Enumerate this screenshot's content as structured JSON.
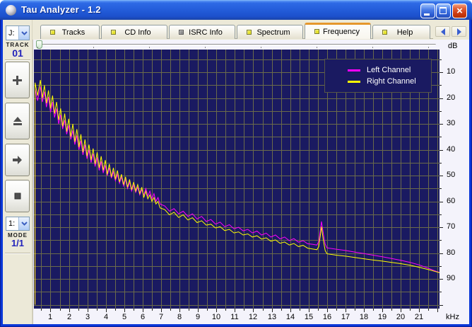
{
  "window": {
    "title": "Tau Analyzer - 1.2",
    "controls": {
      "minimize": "minimize",
      "maximize": "maximize",
      "close": "close"
    }
  },
  "sidebar": {
    "track_combo": {
      "value": "J:"
    },
    "track_label": "TRACK",
    "track_number": "01",
    "buttons": [
      {
        "icon": "plus"
      },
      {
        "icon": "eject"
      },
      {
        "icon": "arrow-right"
      },
      {
        "icon": "stop"
      }
    ],
    "mode_combo": {
      "value": "1:"
    },
    "mode_label": "MODE",
    "mode_value": "1/1"
  },
  "tabs": [
    {
      "label": "Tracks",
      "led": "on",
      "active": false
    },
    {
      "label": "CD Info",
      "led": "on",
      "active": false
    },
    {
      "label": "ISRC Info",
      "led": "off",
      "active": false
    },
    {
      "label": "Spectrum",
      "led": "on",
      "active": false
    },
    {
      "label": "Frequency",
      "led": "on",
      "active": true
    },
    {
      "label": "Help",
      "led": "on",
      "active": false
    }
  ],
  "legend": {
    "entries": [
      {
        "label": "Left Channel",
        "color": "#ff00ff"
      },
      {
        "label": "Right Channel",
        "color": "#ffff00"
      }
    ]
  },
  "colors": {
    "accent_orange": "#e5972d",
    "chart_bg": "#1a1a61",
    "grid": "#6b6b4a",
    "axis_bg": "#f4f3fb",
    "led_on": "#e8e431",
    "led_off": "#919191",
    "track_number_blue": "#2222bb",
    "left_channel": "#ff00ff",
    "right_channel": "#ffff00"
  },
  "chart_data": {
    "type": "line",
    "title": "",
    "xlabel": "kHz",
    "ylabel": "dB",
    "xlim": [
      0.1,
      22.1
    ],
    "ylim_db": [
      -101.5,
      -1.2
    ],
    "grid": {
      "x_step_khz": 0.5,
      "y_step_db": 5,
      "on": true
    },
    "legend_position": "top-right",
    "x_ticks": [
      "1",
      "2",
      "3",
      "4",
      "5",
      "6",
      "7",
      "8",
      "9",
      "10",
      "11",
      "12",
      "13",
      "14",
      "15",
      "16",
      "17",
      "18",
      "19",
      "20",
      "21"
    ],
    "y_ticks": [
      "10",
      "20",
      "30",
      "40",
      "50",
      "60",
      "70",
      "80",
      "90"
    ],
    "x_kHz": [
      0.16,
      0.16,
      0.3,
      0.45,
      0.56,
      0.67,
      0.78,
      0.89,
      1.0,
      1.11,
      1.22,
      1.33,
      1.44,
      1.55,
      1.66,
      1.77,
      1.88,
      1.99,
      2.1,
      2.21,
      2.32,
      2.43,
      2.54,
      2.65,
      2.76,
      2.87,
      2.98,
      3.09,
      3.2,
      3.31,
      3.42,
      3.53,
      3.64,
      3.75,
      3.86,
      3.97,
      4.08,
      4.19,
      4.3,
      4.41,
      4.52,
      4.63,
      4.74,
      4.85,
      4.96,
      5.07,
      5.18,
      5.29,
      5.4,
      5.51,
      5.62,
      5.73,
      5.84,
      5.95,
      6.06,
      6.17,
      6.28,
      6.39,
      6.5,
      6.61,
      6.72,
      6.83,
      6.94,
      7.2,
      7.45,
      7.7,
      7.95,
      8.2,
      8.45,
      8.7,
      8.95,
      9.2,
      9.45,
      9.7,
      9.95,
      10.2,
      10.45,
      10.7,
      10.95,
      11.2,
      11.45,
      11.7,
      11.95,
      12.2,
      12.45,
      12.7,
      12.95,
      13.2,
      13.45,
      13.7,
      13.95,
      14.2,
      14.45,
      14.7,
      14.95,
      15.2,
      15.45,
      15.55,
      15.65,
      15.7,
      15.8,
      15.9,
      16.0,
      16.5,
      17.0,
      17.5,
      18.0,
      18.5,
      19.0,
      19.5,
      20.0,
      20.5,
      21.0,
      21.5,
      21.9,
      22.1
    ],
    "series": [
      {
        "name": "Left Channel",
        "color": "#ff00ff",
        "db": [
          -100,
          -16.5,
          -21,
          -15.5,
          -21.5,
          -17.5,
          -23.5,
          -19.5,
          -25.5,
          -21.5,
          -27.5,
          -24.0,
          -30.0,
          -26.5,
          -32.0,
          -28.5,
          -34.0,
          -30.5,
          -36.0,
          -32.5,
          -38.0,
          -34.5,
          -40.0,
          -36.5,
          -42.0,
          -38.0,
          -43.5,
          -40.0,
          -45.0,
          -41.5,
          -46.5,
          -43.0,
          -48.0,
          -44.5,
          -49.0,
          -46.0,
          -50.0,
          -47.0,
          -51.0,
          -48.5,
          -52.0,
          -49.5,
          -53.0,
          -50.5,
          -54.0,
          -51.5,
          -55.0,
          -52.5,
          -56.0,
          -53.5,
          -56.5,
          -54.5,
          -57.5,
          -55.5,
          -57.5,
          -55.0,
          -58.0,
          -56.0,
          -59.0,
          -57.0,
          -60.0,
          -58.5,
          -61.0,
          -61.8,
          -63.8,
          -62.8,
          -64.8,
          -63.8,
          -65.8,
          -64.8,
          -66.8,
          -65.8,
          -67.8,
          -67.0,
          -68.8,
          -68.0,
          -69.8,
          -69.0,
          -70.6,
          -70.0,
          -71.4,
          -70.8,
          -72.2,
          -71.5,
          -73.0,
          -72.3,
          -73.8,
          -73.0,
          -74.5,
          -73.8,
          -75.2,
          -74.4,
          -75.8,
          -75.2,
          -76.4,
          -76.6,
          -76.9,
          -75.5,
          -70.5,
          -67.8,
          -72.5,
          -76.5,
          -78.0,
          -78.5,
          -79.0,
          -79.6,
          -80.2,
          -80.8,
          -81.4,
          -82.1,
          -82.8,
          -83.6,
          -84.6,
          -85.9,
          -87.0,
          -87.5
        ]
      },
      {
        "name": "Right Channel",
        "color": "#ffff00",
        "db": [
          -100,
          -14,
          -19,
          -13.0,
          -20.0,
          -15.0,
          -22.0,
          -17.0,
          -24.0,
          -19.0,
          -26.0,
          -21.5,
          -28.5,
          -24.0,
          -31.0,
          -26.0,
          -33.0,
          -28.0,
          -35.0,
          -30.0,
          -37.0,
          -32.0,
          -39.0,
          -34.0,
          -41.0,
          -36.0,
          -42.5,
          -38.0,
          -44.0,
          -39.5,
          -45.5,
          -41.0,
          -47.0,
          -42.5,
          -48.0,
          -44.0,
          -49.5,
          -45.5,
          -50.5,
          -47.0,
          -51.5,
          -48.0,
          -52.5,
          -49.5,
          -53.5,
          -50.5,
          -54.5,
          -51.5,
          -55.5,
          -52.5,
          -56.0,
          -53.5,
          -57.0,
          -54.5,
          -58.5,
          -56.0,
          -59.0,
          -57.5,
          -60.0,
          -58.5,
          -61.0,
          -60.0,
          -62.5,
          -63.2,
          -65.2,
          -64.2,
          -66.2,
          -65.2,
          -67.2,
          -66.3,
          -68.2,
          -67.5,
          -69.2,
          -68.8,
          -70.3,
          -69.8,
          -71.3,
          -70.8,
          -72.2,
          -71.8,
          -73.0,
          -72.6,
          -73.8,
          -73.3,
          -74.6,
          -74.1,
          -75.4,
          -74.9,
          -76.2,
          -75.7,
          -76.9,
          -76.3,
          -77.5,
          -77.0,
          -78.1,
          -78.4,
          -78.7,
          -77.5,
          -72.5,
          -69.8,
          -75.0,
          -79.0,
          -80.3,
          -80.8,
          -81.2,
          -81.7,
          -82.2,
          -82.7,
          -83.1,
          -83.6,
          -84.1,
          -84.7,
          -85.5,
          -86.4,
          -87.2,
          -87.6
        ]
      }
    ]
  }
}
